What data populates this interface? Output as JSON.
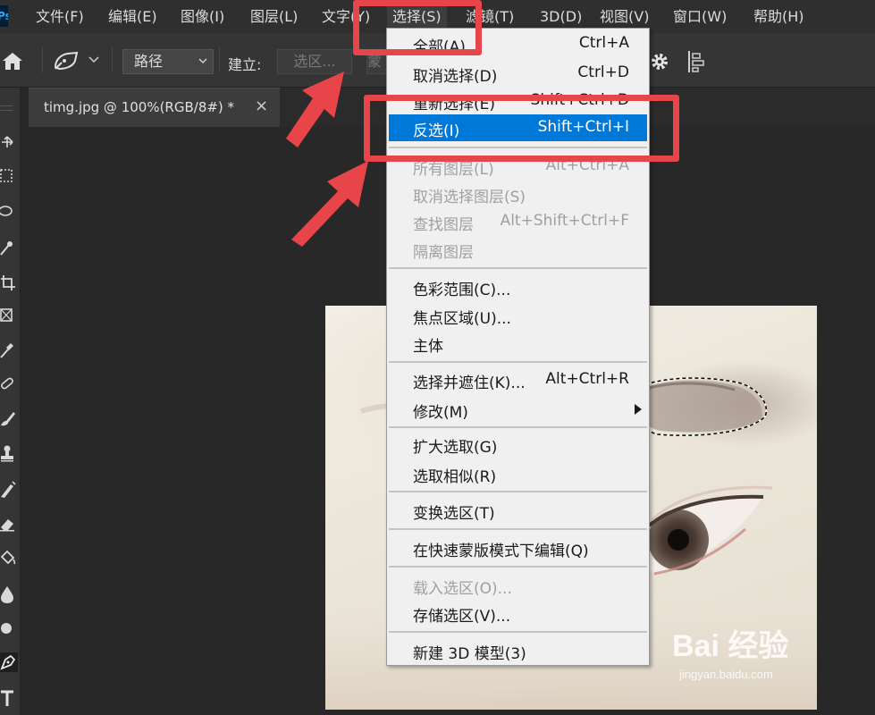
{
  "menubar": {
    "items": [
      {
        "label": "文件(F)"
      },
      {
        "label": "编辑(E)"
      },
      {
        "label": "图像(I)"
      },
      {
        "label": "图层(L)"
      },
      {
        "label": "文字(Y)"
      },
      {
        "label": "选择(S)"
      },
      {
        "label": "滤镜(T)"
      },
      {
        "label": "3D(D)"
      },
      {
        "label": "视图(V)"
      },
      {
        "label": "窗口(W)"
      },
      {
        "label": "帮助(H)"
      }
    ],
    "logo_text": "Ps"
  },
  "options": {
    "path_mode": "路径",
    "make_label": "建立:",
    "selection_button": "选区...",
    "mask_button": "蒙版"
  },
  "document": {
    "tab_title": "timg.jpg @ 100%(RGB/8#) *",
    "close_glyph": "×"
  },
  "select_menu": {
    "items": [
      {
        "label": "全部(A)",
        "shortcut": "Ctrl+A",
        "disabled": false
      },
      {
        "label": "取消选择(D)",
        "shortcut": "Ctrl+D",
        "disabled": false
      },
      {
        "label": "重新选择(E)",
        "shortcut": "Shift+Ctrl+D",
        "disabled": false
      },
      {
        "label": "反选(I)",
        "shortcut": "Shift+Ctrl+I",
        "disabled": false,
        "highlighted": true
      },
      {
        "label": "所有图层(L)",
        "shortcut": "Alt+Ctrl+A",
        "disabled": true
      },
      {
        "label": "取消选择图层(S)",
        "shortcut": "",
        "disabled": true
      },
      {
        "label": "查找图层",
        "shortcut": "Alt+Shift+Ctrl+F",
        "disabled": true
      },
      {
        "label": "隔离图层",
        "shortcut": "",
        "disabled": true
      },
      {
        "label": "色彩范围(C)...",
        "shortcut": "",
        "disabled": false
      },
      {
        "label": "焦点区域(U)...",
        "shortcut": "",
        "disabled": false
      },
      {
        "label": "主体",
        "shortcut": "",
        "disabled": false
      },
      {
        "label": "选择并遮住(K)...",
        "shortcut": "Alt+Ctrl+R",
        "disabled": false
      },
      {
        "label": "修改(M)",
        "shortcut": "",
        "disabled": false,
        "submenu": true
      },
      {
        "label": "扩大选取(G)",
        "shortcut": "",
        "disabled": false
      },
      {
        "label": "选取相似(R)",
        "shortcut": "",
        "disabled": false
      },
      {
        "label": "变换选区(T)",
        "shortcut": "",
        "disabled": false
      },
      {
        "label": "在快速蒙版模式下编辑(Q)",
        "shortcut": "",
        "disabled": false
      },
      {
        "label": "载入选区(O)...",
        "shortcut": "",
        "disabled": true
      },
      {
        "label": "存储选区(V)...",
        "shortcut": "",
        "disabled": false
      },
      {
        "label": "新建 3D 模型(3)",
        "shortcut": "",
        "disabled": false
      }
    ]
  },
  "watermark": {
    "brand": "Bai 经验",
    "url": "jingyan.baidu.com"
  },
  "colors": {
    "annotation_red": "#e8454a",
    "menu_highlight": "#0078d7"
  }
}
